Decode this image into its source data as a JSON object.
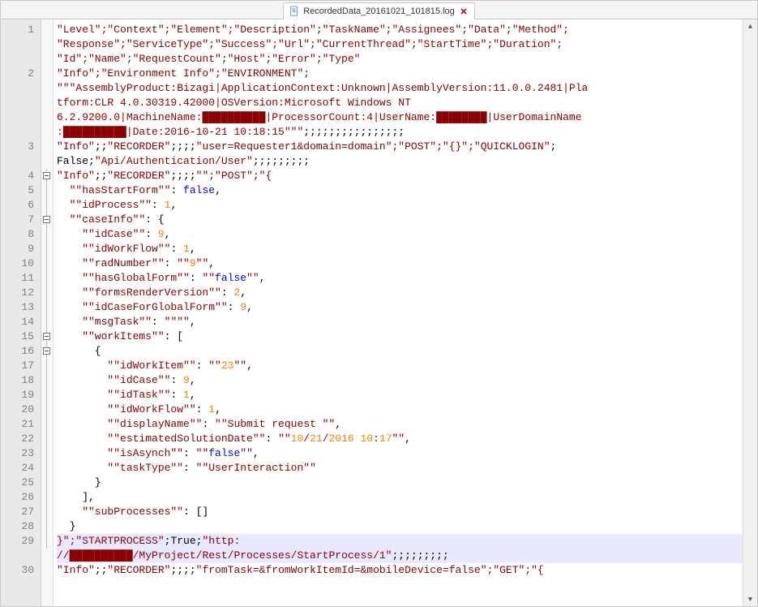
{
  "tab": {
    "filename": "RecordedData_20161021_101815.log"
  },
  "gutter": {
    "start": 1
  },
  "lines": [
    {
      "n": 1,
      "tokens": [
        [
          "\"Level\";\"Context\";\"Element\";\"Description\";\"TaskName\";\"Assignees\";\"Data\";\"Method\";",
          "red"
        ]
      ]
    },
    {
      "n": null,
      "tokens": [
        [
          "\"Response\";\"ServiceType\";\"Success\";\"Url\";\"CurrentThread\";\"StartTime\";\"Duration\";",
          "red"
        ]
      ]
    },
    {
      "n": null,
      "tokens": [
        [
          "\"Id\";\"Name\";\"RequestCount\";\"Host\";\"Error\";\"Type\"",
          "red"
        ]
      ]
    },
    {
      "n": 2,
      "tokens": [
        [
          "\"Info\";\"Environment Info\";\"ENVIRONMENT\";",
          "red"
        ]
      ]
    },
    {
      "n": null,
      "tokens": [
        [
          "\"\"\"AssemblyProduct:Bizagi|ApplicationContext:Unknown|AssemblyVersion:11.0.0.2481|Pla",
          "red"
        ]
      ]
    },
    {
      "n": null,
      "tokens": [
        [
          "tform:CLR 4.0.30319.42000|OSVersion:Microsoft Windows NT ",
          "red"
        ]
      ]
    },
    {
      "n": null,
      "tokens": [
        [
          "6.2.9200.0|MachineName:",
          "red"
        ],
        [
          "██████████",
          "red"
        ],
        [
          "|ProcessorCount:4|UserName:",
          "red"
        ],
        [
          "████████",
          "red"
        ],
        [
          "|UserDomainName",
          "red"
        ]
      ]
    },
    {
      "n": null,
      "tokens": [
        [
          ":",
          "red"
        ],
        [
          "██████████",
          "red"
        ],
        [
          "|Date:2016-10-21 10:18:15\"\"\"",
          "red"
        ],
        [
          ";;;;;;;;;;;;;;;;",
          "black"
        ]
      ]
    },
    {
      "n": 3,
      "tokens": [
        [
          "\"Info\"",
          "red"
        ],
        [
          ";;",
          "black"
        ],
        [
          "\"RECORDER\"",
          "red"
        ],
        [
          ";;;;",
          "black"
        ],
        [
          "\"user=Requester1&domain=domain\";\"POST\";\"{}\";\"QUICKLOGIN\"",
          "red"
        ],
        [
          ";",
          "black"
        ]
      ]
    },
    {
      "n": null,
      "tokens": [
        [
          "False",
          "black"
        ],
        [
          ";",
          "black"
        ],
        [
          "\"Api/Authentication/User\"",
          "red"
        ],
        [
          ";;;;;;;;;",
          "black"
        ]
      ]
    },
    {
      "n": 4,
      "fold": "box",
      "tokens": [
        [
          "\"Info\"",
          "red"
        ],
        [
          ";;",
          "black"
        ],
        [
          "\"RECORDER\"",
          "red"
        ],
        [
          ";;;;",
          "black"
        ],
        [
          "\"\";\"POST\";\"{",
          "red"
        ]
      ]
    },
    {
      "n": 5,
      "fold": "line",
      "tokens": [
        [
          "  \"\"hasStartForm\"\"",
          "red"
        ],
        [
          ": ",
          "black"
        ],
        [
          "false",
          "blue"
        ],
        [
          ",",
          "black"
        ]
      ]
    },
    {
      "n": 6,
      "fold": "line",
      "tokens": [
        [
          "  \"\"idProcess\"\"",
          "red"
        ],
        [
          ": ",
          "black"
        ],
        [
          "1",
          "orange"
        ],
        [
          ",",
          "black"
        ]
      ]
    },
    {
      "n": 7,
      "fold": "box",
      "tokens": [
        [
          "  \"\"caseInfo\"\"",
          "red"
        ],
        [
          ": {",
          "black"
        ]
      ]
    },
    {
      "n": 8,
      "fold": "line",
      "tokens": [
        [
          "    \"\"idCase\"\"",
          "red"
        ],
        [
          ": ",
          "black"
        ],
        [
          "9",
          "orange"
        ],
        [
          ",",
          "black"
        ]
      ]
    },
    {
      "n": 9,
      "fold": "line",
      "tokens": [
        [
          "    \"\"idWorkFlow\"\"",
          "red"
        ],
        [
          ": ",
          "black"
        ],
        [
          "1",
          "orange"
        ],
        [
          ",",
          "black"
        ]
      ]
    },
    {
      "n": 10,
      "fold": "line",
      "tokens": [
        [
          "    \"\"radNumber\"\"",
          "red"
        ],
        [
          ": ",
          "black"
        ],
        [
          "\"\"",
          "red"
        ],
        [
          "9",
          "orange"
        ],
        [
          "\"\"",
          "red"
        ],
        [
          ",",
          "black"
        ]
      ]
    },
    {
      "n": 11,
      "fold": "line",
      "tokens": [
        [
          "    \"\"hasGlobalForm\"\"",
          "red"
        ],
        [
          ": ",
          "black"
        ],
        [
          "\"\"",
          "red"
        ],
        [
          "false",
          "blue"
        ],
        [
          "\"\"",
          "red"
        ],
        [
          ",",
          "black"
        ]
      ]
    },
    {
      "n": 12,
      "fold": "line",
      "tokens": [
        [
          "    \"\"formsRenderVersion\"\"",
          "red"
        ],
        [
          ": ",
          "black"
        ],
        [
          "2",
          "orange"
        ],
        [
          ",",
          "black"
        ]
      ]
    },
    {
      "n": 13,
      "fold": "line",
      "tokens": [
        [
          "    \"\"idCaseForGlobalForm\"\"",
          "red"
        ],
        [
          ": ",
          "black"
        ],
        [
          "9",
          "orange"
        ],
        [
          ",",
          "black"
        ]
      ]
    },
    {
      "n": 14,
      "fold": "line",
      "tokens": [
        [
          "    \"\"msgTask\"\"",
          "red"
        ],
        [
          ": ",
          "black"
        ],
        [
          "\"\"\"\"",
          "red"
        ],
        [
          ",",
          "black"
        ]
      ]
    },
    {
      "n": 15,
      "fold": "box",
      "tokens": [
        [
          "    \"\"workItems\"\"",
          "red"
        ],
        [
          ": [",
          "black"
        ]
      ]
    },
    {
      "n": 16,
      "fold": "box",
      "tokens": [
        [
          "      {",
          "black"
        ]
      ]
    },
    {
      "n": 17,
      "fold": "line",
      "tokens": [
        [
          "        \"\"idWorkItem\"\"",
          "red"
        ],
        [
          ": ",
          "black"
        ],
        [
          "\"\"",
          "red"
        ],
        [
          "23",
          "orange"
        ],
        [
          "\"\"",
          "red"
        ],
        [
          ",",
          "black"
        ]
      ]
    },
    {
      "n": 18,
      "fold": "line",
      "tokens": [
        [
          "        \"\"idCase\"\"",
          "red"
        ],
        [
          ": ",
          "black"
        ],
        [
          "9",
          "orange"
        ],
        [
          ",",
          "black"
        ]
      ]
    },
    {
      "n": 19,
      "fold": "line",
      "tokens": [
        [
          "        \"\"idTask\"\"",
          "red"
        ],
        [
          ": ",
          "black"
        ],
        [
          "1",
          "orange"
        ],
        [
          ",",
          "black"
        ]
      ]
    },
    {
      "n": 20,
      "fold": "line",
      "tokens": [
        [
          "        \"\"idWorkFlow\"\"",
          "red"
        ],
        [
          ": ",
          "black"
        ],
        [
          "1",
          "orange"
        ],
        [
          ",",
          "black"
        ]
      ]
    },
    {
      "n": 21,
      "fold": "line",
      "tokens": [
        [
          "        \"\"displayName\"\"",
          "red"
        ],
        [
          ": ",
          "black"
        ],
        [
          "\"\"Submit request \"\"",
          "red"
        ],
        [
          ",",
          "black"
        ]
      ]
    },
    {
      "n": 22,
      "fold": "line",
      "tokens": [
        [
          "        \"\"estimatedSolutionDate\"\"",
          "red"
        ],
        [
          ": ",
          "black"
        ],
        [
          "\"\"",
          "red"
        ],
        [
          "10",
          "orange"
        ],
        [
          "/",
          "red"
        ],
        [
          "21",
          "orange"
        ],
        [
          "/",
          "red"
        ],
        [
          "2016 10",
          "orange"
        ],
        [
          ":",
          "red"
        ],
        [
          "17",
          "orange"
        ],
        [
          "\"\"",
          "red"
        ],
        [
          ",",
          "black"
        ]
      ]
    },
    {
      "n": 23,
      "fold": "line",
      "tokens": [
        [
          "        \"\"isAsynch\"\"",
          "red"
        ],
        [
          ": ",
          "black"
        ],
        [
          "\"\"",
          "red"
        ],
        [
          "false",
          "blue"
        ],
        [
          "\"\"",
          "red"
        ],
        [
          ",",
          "black"
        ]
      ]
    },
    {
      "n": 24,
      "fold": "line",
      "tokens": [
        [
          "        \"\"taskType\"\"",
          "red"
        ],
        [
          ": ",
          "black"
        ],
        [
          "\"\"UserInteraction\"\"",
          "red"
        ]
      ]
    },
    {
      "n": 25,
      "fold": "line",
      "tokens": [
        [
          "      }",
          "black"
        ]
      ]
    },
    {
      "n": 26,
      "fold": "line",
      "tokens": [
        [
          "    ],",
          "black"
        ]
      ]
    },
    {
      "n": 27,
      "fold": "line",
      "tokens": [
        [
          "    \"\"subProcesses\"\"",
          "red"
        ],
        [
          ": []",
          "black"
        ]
      ]
    },
    {
      "n": 28,
      "fold": "line",
      "tokens": [
        [
          "  }",
          "black"
        ]
      ]
    },
    {
      "n": 29,
      "fold": "line",
      "hl": true,
      "tokens": [
        [
          "}\";\"STARTPROCESS\"",
          "red"
        ],
        [
          ";",
          "black"
        ],
        [
          "True",
          "black"
        ],
        [
          ";",
          "black"
        ],
        [
          "\"http:",
          "red"
        ]
      ]
    },
    {
      "n": null,
      "hl": true,
      "tokens": [
        [
          "//",
          "red"
        ],
        [
          "██████████",
          "red"
        ],
        [
          "/MyProject/Rest/Processes/StartProcess/1\"",
          "red"
        ],
        [
          ";;;;;;;;;",
          "black"
        ]
      ]
    },
    {
      "n": 30,
      "tokens": [
        [
          "\"Info\"",
          "red"
        ],
        [
          ";;",
          "black"
        ],
        [
          "\"RECORDER\"",
          "red"
        ],
        [
          ";;;;",
          "black"
        ],
        [
          "\"fromTask=&fromWorkItemId=&mobileDevice=false\";\"GET\";\"{",
          "red"
        ]
      ]
    }
  ]
}
